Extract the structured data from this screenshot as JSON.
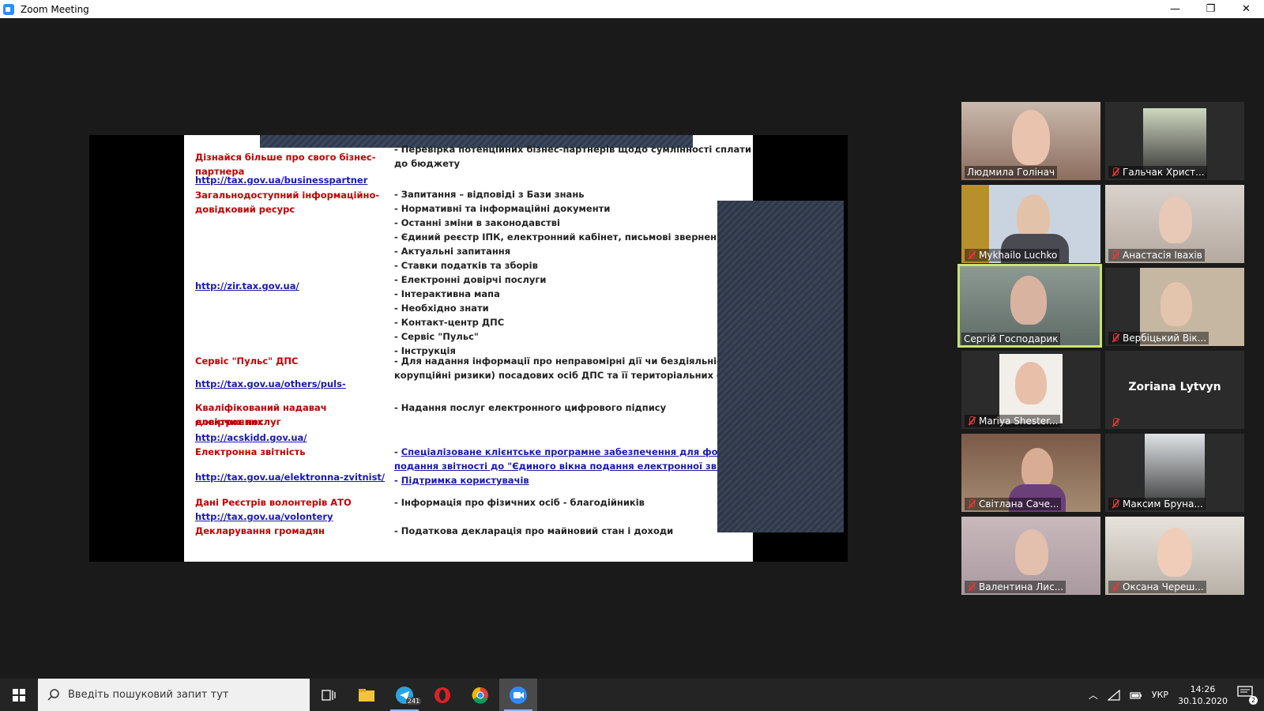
{
  "window": {
    "title": "Zoom Meeting",
    "minimize": "—",
    "restore": "❐",
    "close": "✕"
  },
  "slide": {
    "rows": [
      {
        "left": "Дізнайся більше про свого бізнес-партнера",
        "left_link": false,
        "right": "- Перевірка потенційних бізнес-партнерів щодо сумлінності сплати податків",
        "right2": "до бюджету"
      },
      {
        "left": "http://tax.gov.ua/businesspartner",
        "left_link": true
      },
      {
        "left": "Загальнодоступний інформаційно-",
        "left2": "довідковий ресурс"
      },
      {
        "left": "http://zir.tax.gov.ua/",
        "left_link": true
      }
    ],
    "red_labels": {
      "partner": "Дізнайся більше про свого бізнес-партнера",
      "zir1": "Загальнодоступний інформаційно-",
      "zir2": "довідковий ресурс",
      "puls": "Сервіс \"Пульс\" ДПС",
      "acsk1": "Кваліфікований надавач електронних",
      "acsk2": "довірчих послуг",
      "ereport": "Електронна звітність",
      "ato": "Дані Реєстрів волонтерів АТО",
      "declar": "Декларування громадян"
    },
    "links": {
      "partner": "http://tax.gov.ua/businesspartner",
      "zir": "http://zir.tax.gov.ua/",
      "puls": "http://tax.gov.ua/others/puls-",
      "acsk": "http://acskidd.gov.ua/",
      "ereport": "http://tax.gov.ua/elektronna-zvitnist/",
      "ato": "http://tax.gov.ua/volontery"
    },
    "right_text": {
      "partner1": "- Перевірка потенційних бізнес-партнерів щодо сумлінності сплати податків",
      "partner2": "до бюджету",
      "zir_items": [
        "- Запитання – відповіді з Бази знань",
        "- Нормативні та інформаційні документи",
        "- Останні зміни в законодавстві",
        "- Єдиний реєстр ІПК, електронний кабінет, письмові звернення",
        "- Актуальні запитання",
        "- Ставки податків та зборів",
        "- Електронні довірчі послуги",
        "- Інтерактивна мапа",
        "- Необхідно знати",
        "- Контакт-центр ДПС",
        "- Сервіс \"Пульс\"",
        "- Інструкція"
      ],
      "puls1": "- Для надання інформації про неправомірні дії чи бездіяльність (можли",
      "puls2": "корупційні ризики) посадових осіб ДПС та її територіальних органів",
      "acsk": "- Надання послуг електронного цифрового підпису",
      "ereport_dash": "- ",
      "ereport1": "Спеціалізоване клієнтське програмне забезпечення для формування та",
      "ereport2": "подання звітності до \"Єдиного вікна подання електронної звітності\"",
      "ereport3": "Підтримка користувачів",
      "ato": "-  Інформація про фізичних осіб - благодійників",
      "declar": "-  Податкова декларація про майновий стан і доходи"
    }
  },
  "participants": [
    {
      "name": "Людмила Голінач",
      "muted": false
    },
    {
      "name": "Гальчак Христ...",
      "muted": true
    },
    {
      "name": "Mykhailo Luchko",
      "muted": true
    },
    {
      "name": "Анастасія Іваxів",
      "muted": true
    },
    {
      "name": "Сергій Господарик",
      "muted": false,
      "active": true
    },
    {
      "name": "Вербіцький Вік...",
      "muted": true
    },
    {
      "name": "Mariya Shester...",
      "muted": true
    },
    {
      "name": "Zoriana Lytvyn",
      "muted": true,
      "no_video": true
    },
    {
      "name": "Світлана Саче...",
      "muted": true
    },
    {
      "name": "Максим Бруна...",
      "muted": true
    },
    {
      "name": "Валентина Лис...",
      "muted": true
    },
    {
      "name": "Оксана Череш...",
      "muted": true
    }
  ],
  "taskbar": {
    "search_placeholder": "Введіть пошуковий запит тут",
    "telegram_badge": "241",
    "language": "УКР",
    "time": "14:26",
    "date": "30.10.2020",
    "notifications": "2"
  }
}
